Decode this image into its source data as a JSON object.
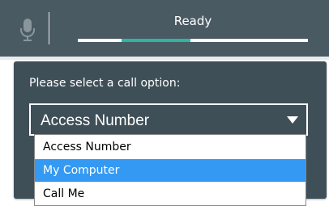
{
  "header": {
    "status_text": "Ready",
    "mic_icon": "microphone-icon",
    "progress": {
      "segments": [
        {
          "from": 0.0,
          "to": 0.19,
          "color": "#ffffff"
        },
        {
          "from": 0.19,
          "to": 0.49,
          "color": "#2fb5a1"
        },
        {
          "from": 0.49,
          "to": 1.0,
          "color": "#ffffff"
        }
      ]
    }
  },
  "panel": {
    "prompt": "Please select a call option:",
    "select": {
      "value": "Access Number",
      "chevron_icon": "chevron-down-icon"
    }
  },
  "dropdown": {
    "options": [
      {
        "label": "Access Number",
        "selected": false
      },
      {
        "label": "My Computer",
        "selected": true
      },
      {
        "label": "Call Me",
        "selected": false
      }
    ]
  },
  "colors": {
    "header_bg": "#4a5a63",
    "panel_bg": "#3f4f58",
    "accent_teal": "#2fb5a1",
    "selection_blue": "#3399f3"
  }
}
